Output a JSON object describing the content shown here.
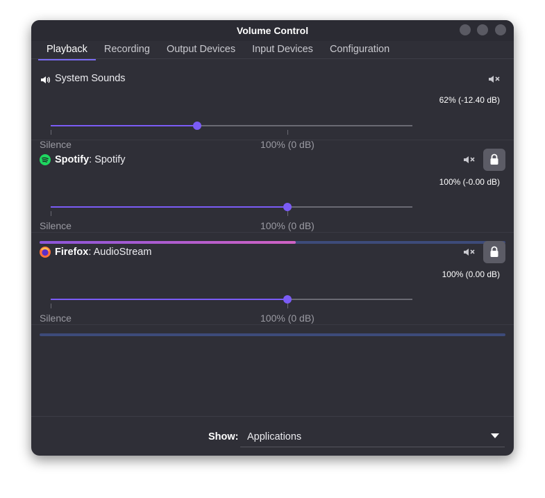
{
  "window": {
    "title": "Volume Control"
  },
  "tabs": [
    {
      "label": "Playback",
      "active": true
    },
    {
      "label": "Recording"
    },
    {
      "label": "Output Devices"
    },
    {
      "label": "Input Devices"
    },
    {
      "label": "Configuration"
    }
  ],
  "streams": [
    {
      "app": "",
      "name": "System Sounds",
      "icon": "speaker-icon",
      "volume_text": "62% (-12.40 dB)",
      "volume_fraction": 0.62,
      "muted": false,
      "has_lock": false,
      "has_meter": false,
      "marks": {
        "silence": "Silence",
        "base": "100% (0 dB)"
      }
    },
    {
      "app": "Spotify",
      "name": ": Spotify",
      "icon": "spotify-icon",
      "volume_text": "100% (-0.00 dB)",
      "volume_fraction": 1.0,
      "muted": false,
      "has_lock": true,
      "has_meter": true,
      "meter_level": 0.55,
      "marks": {
        "silence": "Silence",
        "base": "100% (0 dB)"
      }
    },
    {
      "app": "Firefox",
      "name": ": AudioStream",
      "icon": "firefox-icon",
      "volume_text": "100% (0.00 dB)",
      "volume_fraction": 1.0,
      "muted": false,
      "has_lock": true,
      "has_meter": true,
      "meter_level": 0.0,
      "marks": {
        "silence": "Silence",
        "base": "100% (0 dB)"
      }
    }
  ],
  "footer": {
    "show_label": "Show:",
    "show_value": "Applications"
  },
  "colors": {
    "accent": "#7b5cf6",
    "window_bg": "#2f2f37",
    "meter_bg": "#3d4b7a"
  }
}
